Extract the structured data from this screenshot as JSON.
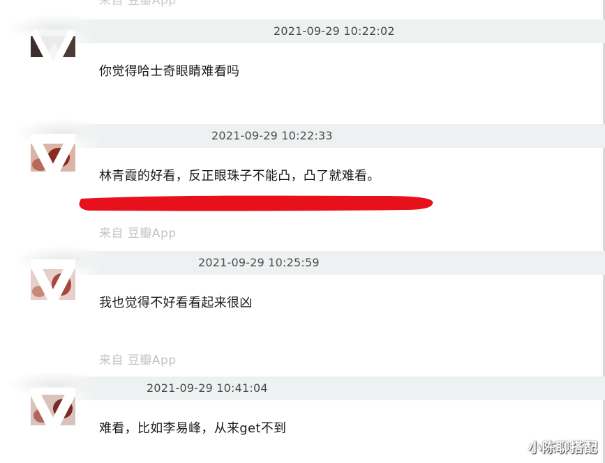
{
  "top_source": "来自 豆瓣App",
  "comments": [
    {
      "time": "2021-09-29 10:22:02",
      "text": "你觉得哈士奇眼睛难看吗",
      "source": ""
    },
    {
      "time": "2021-09-29 10:22:33",
      "text": "林青霞的好看，反正眼珠子不能凸，凸了就难看。",
      "source": "来自 豆瓣App"
    },
    {
      "time": "2021-09-29 10:25:59",
      "text": "我也觉得不好看看起来很凶",
      "source": "来自 豆瓣App"
    },
    {
      "time": "2021-09-29 10:41:04",
      "text": "难看，比如李易峰，从来get不到",
      "source": ""
    }
  ],
  "highlight_color": "#e8101a",
  "watermark": "小陈聊搭配"
}
